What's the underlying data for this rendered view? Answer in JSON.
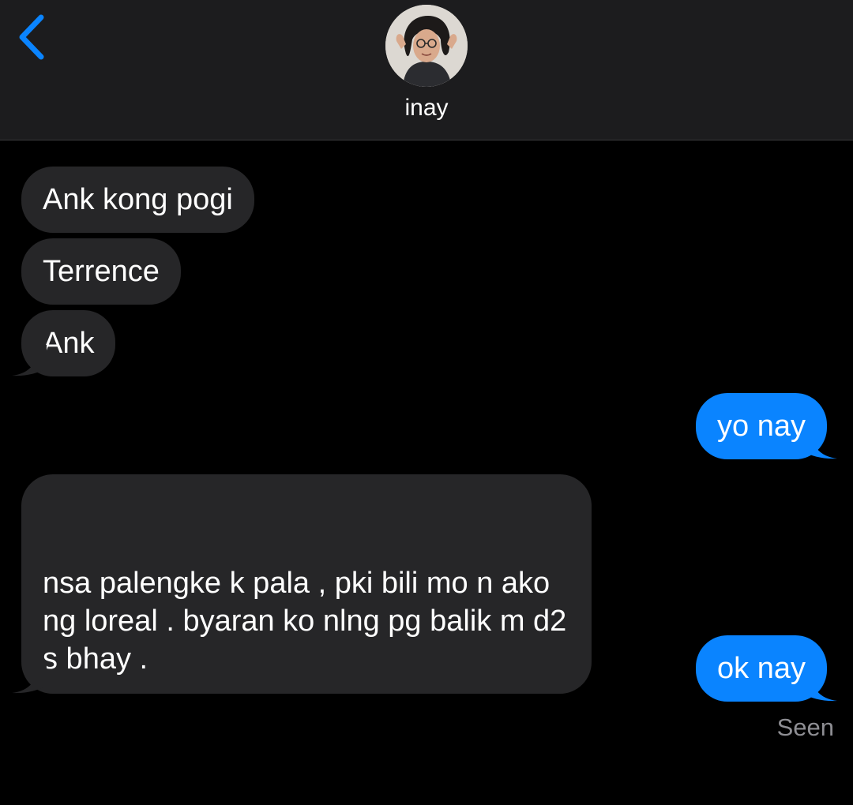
{
  "header": {
    "contact_name": "inay",
    "back_icon": "chevron-left-icon"
  },
  "messages": [
    {
      "direction": "incoming",
      "text": "Ank kong pogi"
    },
    {
      "direction": "incoming",
      "text": "Terrence"
    },
    {
      "direction": "incoming",
      "text": "Ank"
    },
    {
      "direction": "outgoing",
      "text": "yo nay"
    },
    {
      "direction": "incoming",
      "text": "nsa palengke k pala , pki bili mo n ako\nng loreal . byaran ko nlng pg balik m d2\ns bhay ."
    },
    {
      "direction": "outgoing",
      "text": "ok nay"
    }
  ],
  "status": {
    "read_receipt": "Seen"
  },
  "colors": {
    "background": "#000000",
    "header_background": "#1c1c1e",
    "incoming_bubble": "#262628",
    "outgoing_bubble": "#0a84ff",
    "accent": "#0a84ff",
    "secondary_text": "#8e8e93"
  }
}
